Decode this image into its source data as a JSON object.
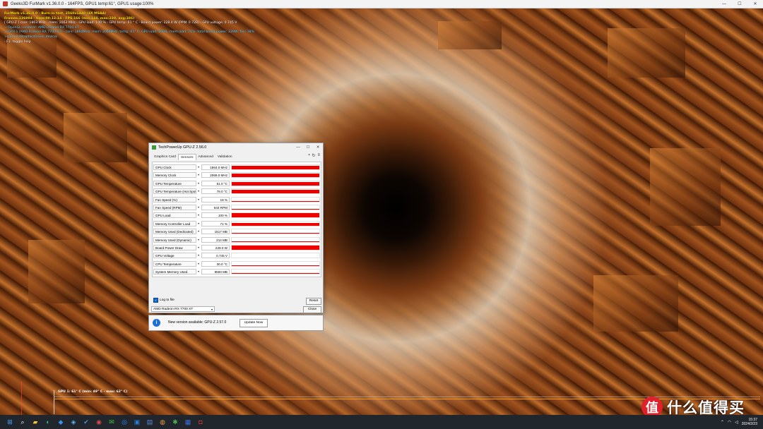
{
  "titlebar": {
    "title": "Geeks3D FurMark v1.36.0.0 - 164FPS, GPU1 temp:61°, GPU1 usage:100%",
    "min": "—",
    "max": "☐",
    "close": "✕"
  },
  "overlay": {
    "lines": [
      {
        "text": "FurMark v1.36.0.0 - Burn-in test, 2560x1440 (4X MSAA)",
        "cls": "ov-yellow"
      },
      {
        "text": "Frames:136984 - time:00:12:14 - FPS:166 (min:144, max:230, avg:186)",
        "cls": "ov-yellow"
      },
      {
        "text": "[ GPU-Z ] core: 1863 MHz - mem: 2063 MHz - GPU load: 100 % - GPU temp: 61 ° C - Board power: 228.0 W (PPW: 0.728) - GPU voltage: 0.745 V",
        "cls": "ov-white"
      },
      {
        "text": "> OpenGL renderer: AMD Radeon RX 7700 XT",
        "cls": "ov-cyan"
      },
      {
        "text": "> GPU 1 (AMD Radeon RX 7700 XT) - core: 1864MHz, mem: 2069MHz, temp: 61° C, GPU load: 100%, mem load: 71%, total board power: 229W, fan: 18%",
        "cls": "ov-cyan"
      },
      {
        "text": "> GPU 2 (OraphicsDriver device)",
        "cls": "ov-cyan"
      },
      {
        "text": "- F1: toggle help",
        "cls": "ov-white"
      }
    ]
  },
  "graph": {
    "label": "GPU 1: 61° C (min: 49° C - max: 62° C)"
  },
  "gpuz": {
    "title": "TechPowerUp GPU-Z 2.56.0",
    "tabs": [
      "Graphics Card",
      "Sensors",
      "Advanced",
      "Validation"
    ],
    "active_tab": "Sensors",
    "sensors": [
      {
        "name": "GPU Clock",
        "value": "1864.0 MHz",
        "level": 0.9
      },
      {
        "name": "Memory Clock",
        "value": "2069.0 MHz",
        "level": 0.95
      },
      {
        "name": "GPU Temperature",
        "value": "61.0 °C",
        "level": 0.75
      },
      {
        "name": "GPU Temperature (Hot Spot)",
        "value": "79.0 °C",
        "level": 0.8
      },
      {
        "name": "Fan Speed (%)",
        "value": "18 %",
        "level": 0.15
      },
      {
        "name": "Fan Speed (RPM)",
        "value": "844 RPM",
        "level": 0.15
      },
      {
        "name": "GPU Load",
        "value": "100 %",
        "level": 1.0
      },
      {
        "name": "Memory Controller Load",
        "value": "71 %",
        "level": 0.7
      },
      {
        "name": "Memory Used (Dedicated)",
        "value": "1517 MB",
        "level": 0.12
      },
      {
        "name": "Memory Used (Dynamic)",
        "value": "214 MB",
        "level": 0.05
      },
      {
        "name": "Board Power Draw",
        "value": "229.0 W",
        "level": 0.95
      },
      {
        "name": "GPU Voltage",
        "value": "0.745 V",
        "level": 0.1
      },
      {
        "name": "CPU Temperature",
        "value": "30.0 °C",
        "level": 0.1
      },
      {
        "name": "System Memory Used",
        "value": "8593 MB",
        "level": 0.1
      }
    ],
    "log_label": "Log to file",
    "reset_label": "Reset",
    "device_select": "AMD Radeon RX 7700 XT",
    "close_label": "Close"
  },
  "update": {
    "message": "New version available: GPU-Z 2.57.0",
    "button": "Update Now"
  },
  "watermark": {
    "logo": "值",
    "text": "什么值得买"
  },
  "taskbar": {
    "apps": [
      {
        "icon": "windows-start-icon",
        "glyph": "⊞",
        "color": "#4aa3ff"
      },
      {
        "icon": "search-icon",
        "glyph": "⌕",
        "color": "#ffffff"
      },
      {
        "icon": "file-explorer-icon",
        "glyph": "▰",
        "color": "#f4c430"
      },
      {
        "icon": "edge-browser-icon",
        "glyph": "◐",
        "color": "#2bb7a4"
      },
      {
        "icon": "app-icon-1",
        "glyph": "◆",
        "color": "#3a8ee6"
      },
      {
        "icon": "app-icon-2",
        "glyph": "◈",
        "color": "#5bb0f0"
      },
      {
        "icon": "app-icon-3",
        "glyph": "✔",
        "color": "#4a90d9"
      },
      {
        "icon": "app-icon-4",
        "glyph": "◉",
        "color": "#d94a4a"
      },
      {
        "icon": "wechat-icon",
        "glyph": "✉",
        "color": "#3cc43c"
      },
      {
        "icon": "app-icon-5",
        "glyph": "◎",
        "color": "#2f8cff"
      },
      {
        "icon": "app-icon-6",
        "glyph": "▣",
        "color": "#2a7ad6"
      },
      {
        "icon": "app-icon-7",
        "glyph": "▤",
        "color": "#5a8ad6"
      },
      {
        "icon": "app-icon-8",
        "glyph": "◍",
        "color": "#e8a040"
      },
      {
        "icon": "app-icon-9",
        "glyph": "✱",
        "color": "#4cb050"
      },
      {
        "icon": "app-icon-10",
        "glyph": "▦",
        "color": "#3a6fd6"
      },
      {
        "icon": "furmark-icon",
        "glyph": "◘",
        "color": "#d33a2a"
      }
    ],
    "tray_chevron": "⌃",
    "time": "15:37",
    "date": "2024/2/23"
  }
}
